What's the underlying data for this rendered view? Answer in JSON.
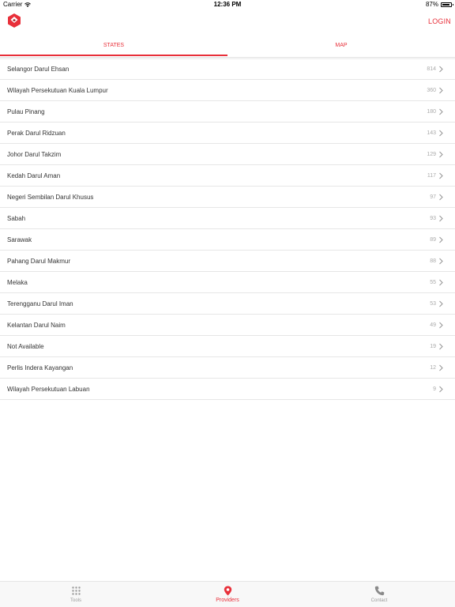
{
  "status_bar": {
    "carrier": "Carrier",
    "time": "12:36 PM",
    "battery": "87%",
    "battery_level": 0.87
  },
  "header": {
    "login_label": "LOGIN",
    "accent_color": "#e8303a"
  },
  "tabs": [
    {
      "label": "STATES",
      "active": true
    },
    {
      "label": "MAP",
      "active": false
    }
  ],
  "states": [
    {
      "name": "Selangor Darul Ehsan",
      "count": "814"
    },
    {
      "name": "Wilayah Persekutuan Kuala Lumpur",
      "count": "360"
    },
    {
      "name": "Pulau Pinang",
      "count": "180"
    },
    {
      "name": "Perak Darul Ridzuan",
      "count": "143"
    },
    {
      "name": "Johor Darul Takzim",
      "count": "129"
    },
    {
      "name": "Kedah Darul Aman",
      "count": "117"
    },
    {
      "name": "Negeri Sembilan Darul Khusus",
      "count": "97"
    },
    {
      "name": "Sabah",
      "count": "93"
    },
    {
      "name": "Sarawak",
      "count": "89"
    },
    {
      "name": "Pahang Darul Makmur",
      "count": "88"
    },
    {
      "name": "Melaka",
      "count": "55"
    },
    {
      "name": "Terengganu Darul Iman",
      "count": "53"
    },
    {
      "name": "Kelantan Darul Naim",
      "count": "49"
    },
    {
      "name": "Not Available",
      "count": "19"
    },
    {
      "name": "Perlis Indera Kayangan",
      "count": "12"
    },
    {
      "name": "Wilayah Persekutuan Labuan",
      "count": "9"
    }
  ],
  "tab_bar": [
    {
      "label": "Tools",
      "icon": "grid-icon",
      "active": false
    },
    {
      "label": "Providers",
      "icon": "map-pin-icon",
      "active": true
    },
    {
      "label": "Contact",
      "icon": "phone-icon",
      "active": false
    }
  ]
}
